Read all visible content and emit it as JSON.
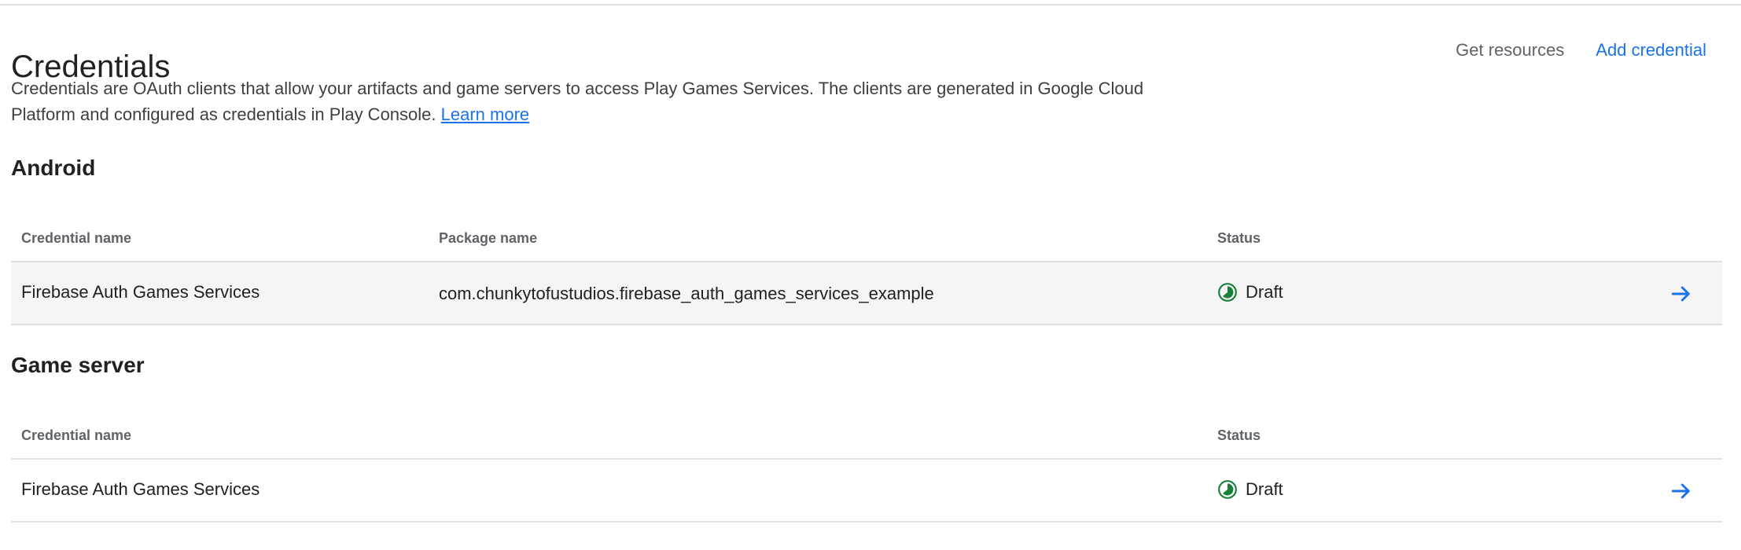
{
  "header": {
    "title": "Credentials",
    "actions": {
      "get_resources": "Get resources",
      "add_credential": "Add credential"
    }
  },
  "intro": {
    "text": "Credentials are OAuth clients that allow your artifacts and game servers to access Play Games Services. The clients are generated in Google Cloud Platform and configured as credentials in Play Console.",
    "link": "Learn more"
  },
  "android": {
    "title": "Android",
    "columns": {
      "name": "Credential name",
      "package": "Package name",
      "status": "Status"
    },
    "rows": [
      {
        "name": "Firebase Auth Games Services",
        "package": "com.chunkytofustudios.firebase_auth_games_services_example",
        "status": "Draft"
      }
    ]
  },
  "game_server": {
    "title": "Game server",
    "columns": {
      "name": "Credential name",
      "status": "Status"
    },
    "rows": [
      {
        "name": "Firebase Auth Games Services",
        "status": "Draft"
      }
    ]
  },
  "colors": {
    "accent": "#1a73e8",
    "status_draft": "#188038",
    "row_highlight": "#f5f5f5"
  },
  "icons": {
    "status": "draft-status-icon",
    "row_action": "arrow-right-icon"
  }
}
